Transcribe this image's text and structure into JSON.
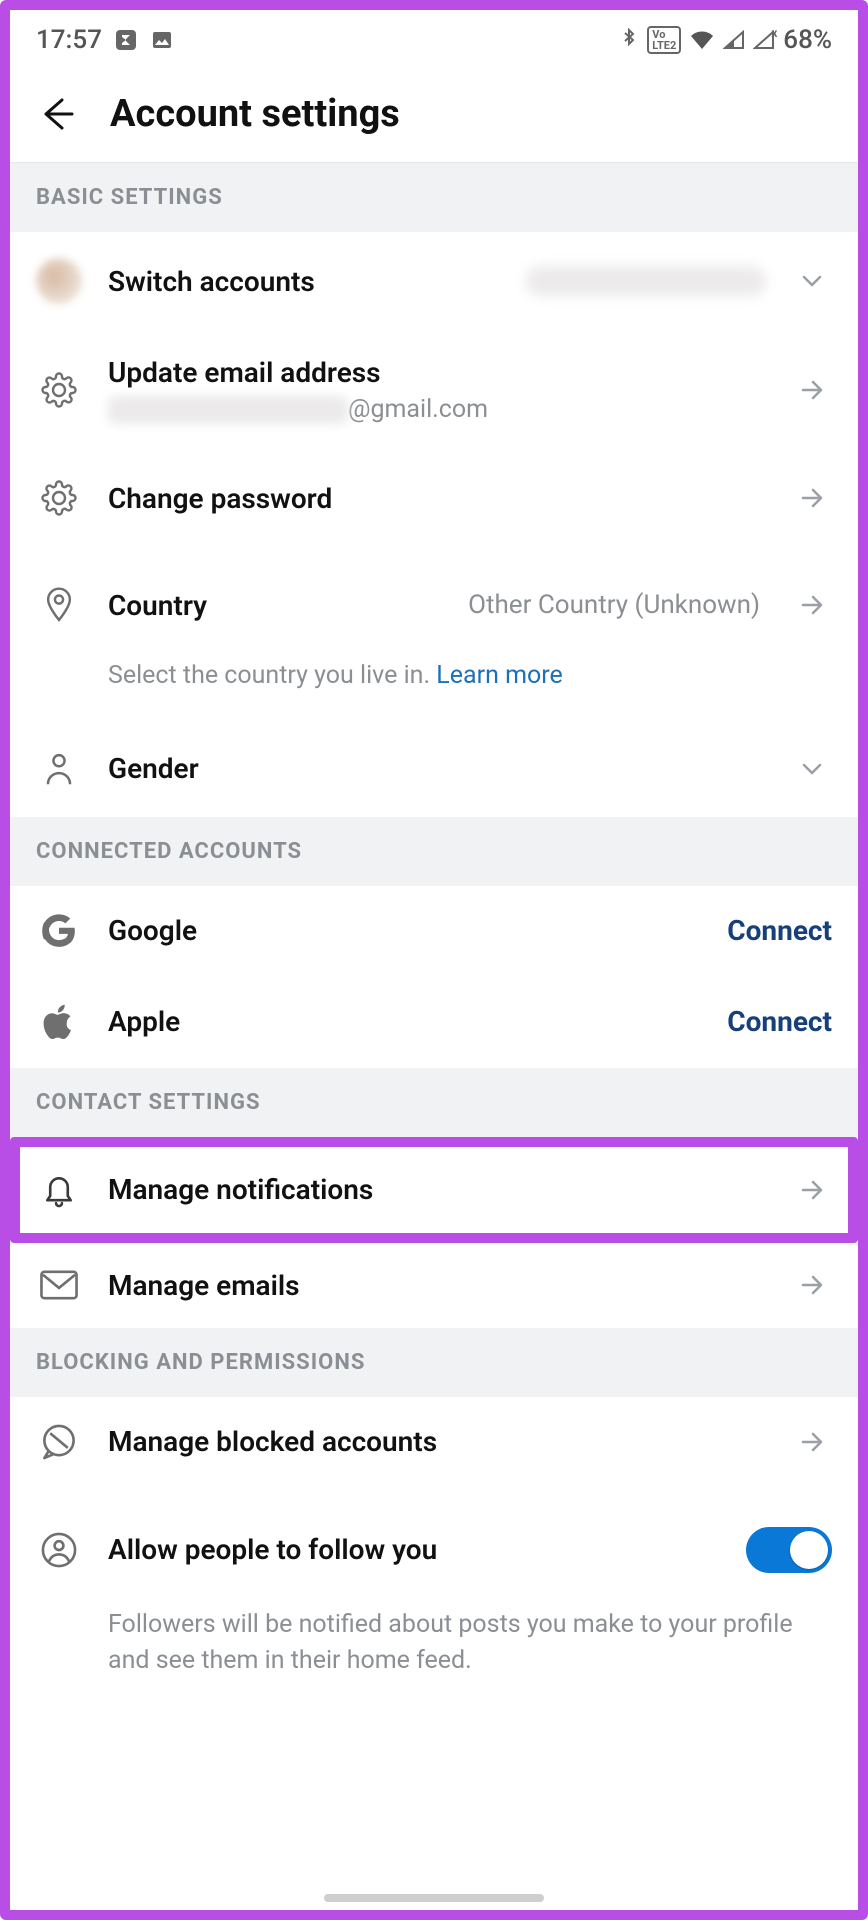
{
  "statusbar": {
    "time": "17:57",
    "battery": "68%",
    "lte_badge": "LTE2"
  },
  "header": {
    "title": "Account settings"
  },
  "sections": {
    "basic": {
      "header": "BASIC SETTINGS",
      "switch_accounts": {
        "label": "Switch accounts"
      },
      "update_email": {
        "label": "Update email address",
        "suffix": "@gmail.com"
      },
      "change_password": {
        "label": "Change password"
      },
      "country": {
        "label": "Country",
        "value": "Other Country (Unknown)",
        "helper_prefix": "Select the country you live in. ",
        "helper_link": "Learn more"
      },
      "gender": {
        "label": "Gender"
      }
    },
    "connected": {
      "header": "CONNECTED ACCOUNTS",
      "google": {
        "label": "Google",
        "action": "Connect"
      },
      "apple": {
        "label": "Apple",
        "action": "Connect"
      }
    },
    "contact": {
      "header": "CONTACT SETTINGS",
      "manage_notifications": {
        "label": "Manage notifications"
      },
      "manage_emails": {
        "label": "Manage emails"
      }
    },
    "blocking": {
      "header": "BLOCKING AND PERMISSIONS",
      "manage_blocked": {
        "label": "Manage blocked accounts"
      },
      "allow_follow": {
        "label": "Allow people to follow you",
        "helper": "Followers will be notified about posts you make to your profile and see them in their home feed."
      }
    }
  }
}
